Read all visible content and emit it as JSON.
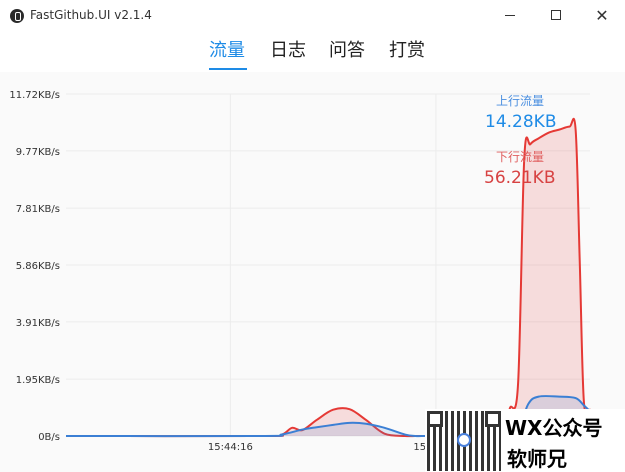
{
  "window": {
    "title": "FastGithub.UI v2.1.4",
    "minimize_glyph": "",
    "maximize_glyph": "",
    "close_glyph": "✕"
  },
  "tabs": [
    {
      "label": "流量",
      "active": true
    },
    {
      "label": "日志",
      "active": false
    },
    {
      "label": "问答",
      "active": false
    },
    {
      "label": "打赏",
      "active": false
    }
  ],
  "legend": {
    "upload_label": "上行流量",
    "upload_total": "14.28KB",
    "download_label": "下行流量",
    "download_total": "56.21KB",
    "upload_color": "#3b7fd4",
    "download_color": "#e53935"
  },
  "chart_data": {
    "type": "area",
    "y_tick_labels": [
      "11.72KB/s",
      "9.77KB/s",
      "7.81KB/s",
      "5.86KB/s",
      "3.91KB/s",
      "1.95KB/s",
      "0B/s"
    ],
    "y_ticks_kbps": [
      11.72,
      9.77,
      7.81,
      5.86,
      3.91,
      1.95,
      0
    ],
    "ylim": [
      0,
      11.72
    ],
    "x_tick_labels": [
      "15:44:16",
      "15:44:26"
    ],
    "x_ticks_s": [
      16,
      26
    ],
    "xlim": [
      8,
      33.5
    ],
    "grid": true,
    "series": [
      {
        "name": "上行流量",
        "color": "#3b7fd4",
        "x": [
          8,
          17.5,
          18.5,
          19.5,
          20.2,
          21,
          21.8,
          22.6,
          23.5,
          24.5,
          25,
          25.5,
          26.2,
          27,
          28.5,
          29.5,
          30,
          30.5,
          31,
          32,
          32.8,
          33.2,
          33.5
        ],
        "y": [
          0,
          0,
          0.05,
          0.22,
          0.3,
          0.38,
          0.45,
          0.42,
          0.28,
          0.05,
          0,
          0,
          0,
          0,
          0,
          0.06,
          0.2,
          1.1,
          1.35,
          1.35,
          1.3,
          1.05,
          0.85
        ]
      },
      {
        "name": "下行流量",
        "color": "#e53935",
        "x": [
          8,
          17.5,
          18.5,
          19,
          19.5,
          20.2,
          21,
          21.8,
          22.6,
          23.5,
          24.5,
          25,
          25.5,
          26.2,
          27,
          28.5,
          29.3,
          29.6,
          30,
          30.3,
          30.6,
          31,
          31.5,
          32,
          32.5,
          32.8,
          33,
          33.2,
          33.5
        ],
        "y": [
          0,
          0,
          0.05,
          0.28,
          0.2,
          0.55,
          0.9,
          0.92,
          0.55,
          0.08,
          0,
          0,
          0,
          0,
          0,
          0.05,
          0.2,
          0.95,
          1.8,
          9.5,
          10.0,
          10.2,
          10.4,
          10.5,
          10.6,
          10.5,
          6.0,
          1.2,
          0.9
        ]
      }
    ]
  },
  "watermark": {
    "line1": "WX公众号",
    "line2": "软师兄"
  }
}
